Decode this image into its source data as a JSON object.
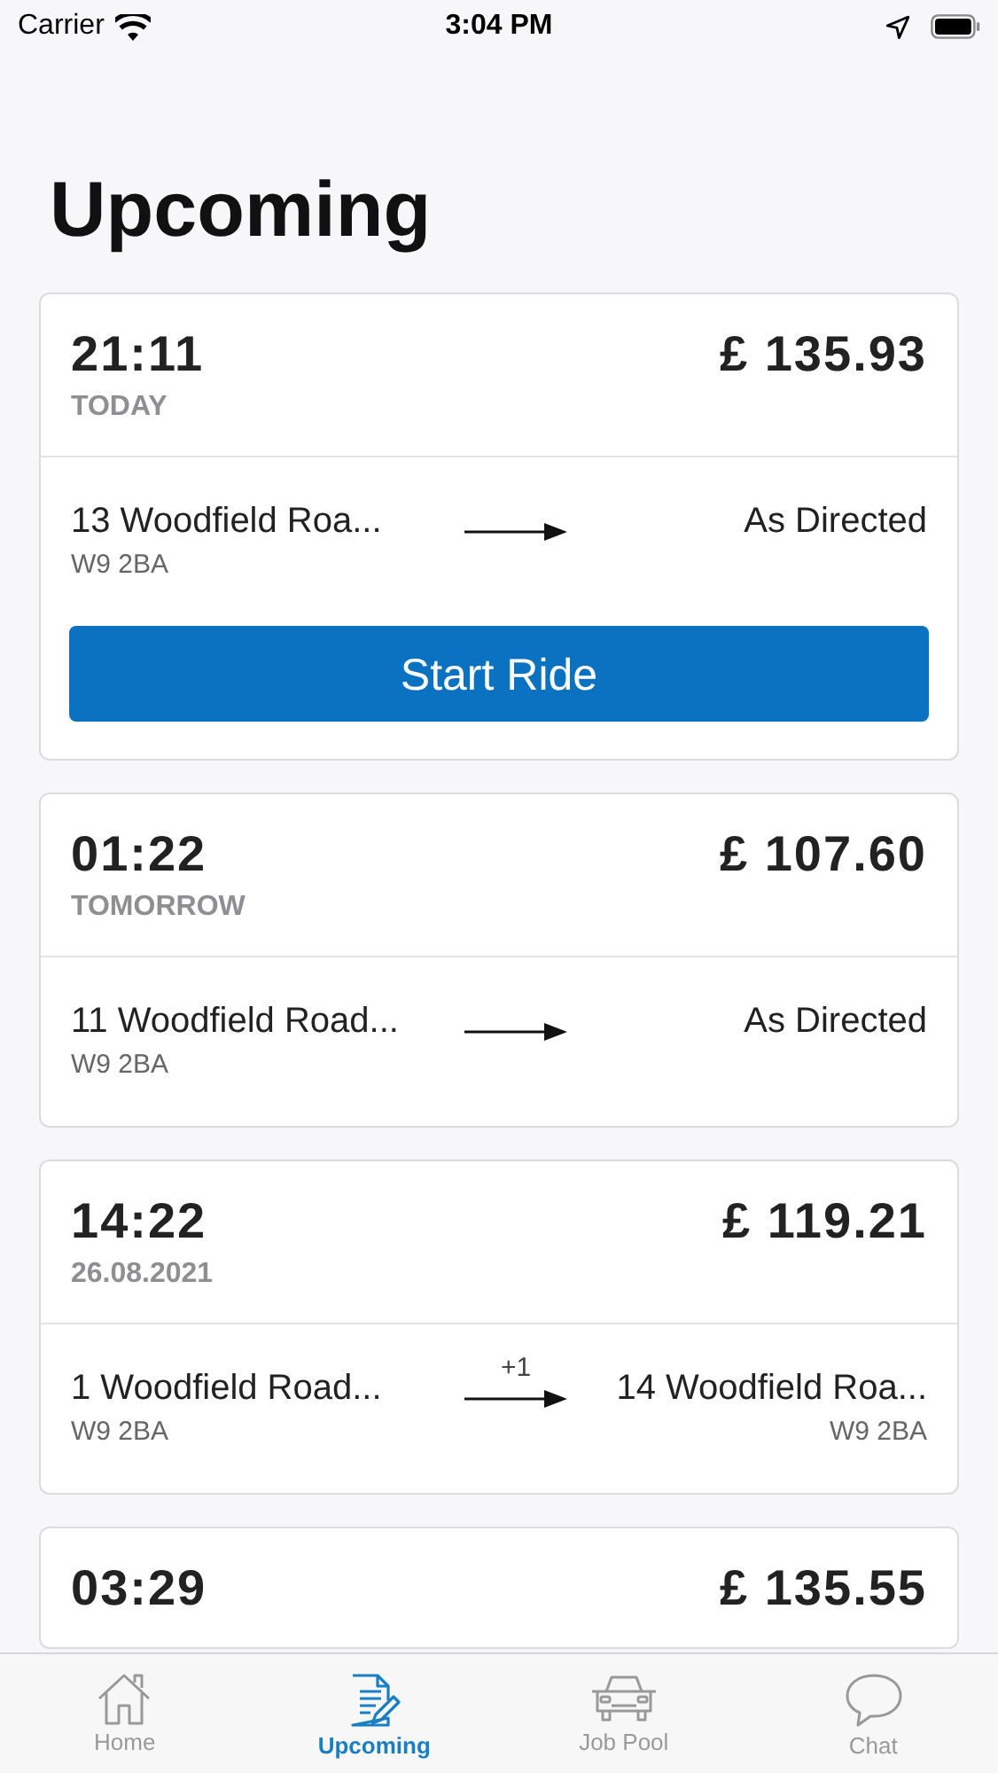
{
  "status_bar": {
    "carrier": "Carrier",
    "time": "3:04 PM"
  },
  "title": "Upcoming",
  "rides": [
    {
      "time": "21:11",
      "day": "TODAY",
      "price": "£ 135.93",
      "pickup": {
        "address": "13 Woodfield Roa...",
        "postcode": "W9 2BA"
      },
      "dropoff": {
        "address": "As Directed"
      },
      "action": "Start Ride"
    },
    {
      "time": "01:22",
      "day": "TOMORROW",
      "price": "£ 107.60",
      "pickup": {
        "address": "11 Woodfield Road...",
        "postcode": "W9 2BA"
      },
      "dropoff": {
        "address": "As Directed"
      }
    },
    {
      "time": "14:22",
      "day": "26.08.2021",
      "price": "£ 119.21",
      "pickup": {
        "address": "1 Woodfield Road...",
        "postcode": "W9 2BA"
      },
      "stops": "+1",
      "dropoff": {
        "address": "14 Woodfield Roa...",
        "postcode": "W9 2BA"
      }
    },
    {
      "time": "03:29",
      "price": "£ 135.55"
    }
  ],
  "tabs": [
    {
      "label": "Home",
      "selected": false
    },
    {
      "label": "Upcoming",
      "selected": true
    },
    {
      "label": "Job Pool",
      "selected": false
    },
    {
      "label": "Chat",
      "selected": false
    }
  ]
}
